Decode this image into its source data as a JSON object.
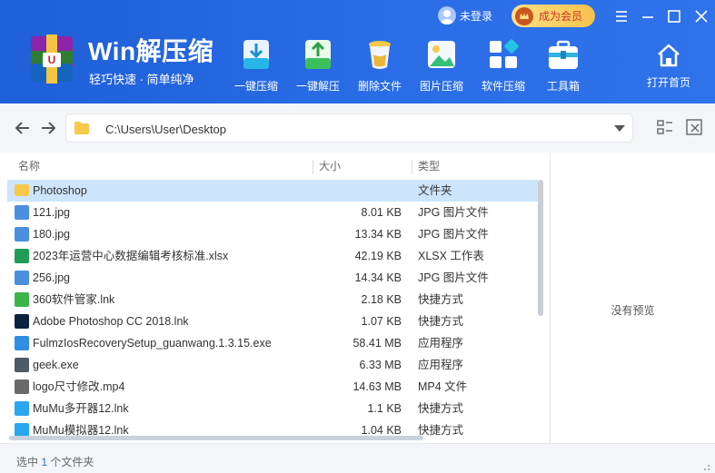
{
  "app": {
    "title": "Win解压缩",
    "subtitle": "轻巧快速 · 简单纯净"
  },
  "account": {
    "login_label": "未登录",
    "vip_label": "成为会员"
  },
  "toolbar": [
    {
      "label": "一键压缩",
      "icon": "one-click-compress-icon"
    },
    {
      "label": "一键解压",
      "icon": "one-click-extract-icon"
    },
    {
      "label": "删除文件",
      "icon": "delete-file-icon"
    },
    {
      "label": "图片压缩",
      "icon": "image-compress-icon"
    },
    {
      "label": "软件压缩",
      "icon": "software-compress-icon"
    },
    {
      "label": "工具箱",
      "icon": "toolbox-icon"
    },
    {
      "label": "打开首页",
      "icon": "home-icon"
    }
  ],
  "address": {
    "path": "C:\\Users\\User\\Desktop"
  },
  "columns": {
    "name": "名称",
    "size": "大小",
    "type": "类型"
  },
  "files": [
    {
      "name": "Photoshop",
      "size": "",
      "type": "文件夹",
      "icon": "folder-icon",
      "color": "#f7c94a",
      "selected": true
    },
    {
      "name": "121.jpg",
      "size": "8.01 KB",
      "type": "JPG 图片文件",
      "icon": "jpg-file-icon",
      "color": "#4a8fe0"
    },
    {
      "name": "180.jpg",
      "size": "13.34 KB",
      "type": "JPG 图片文件",
      "icon": "jpg-file-icon",
      "color": "#4a8fe0"
    },
    {
      "name": "2023年运营中心数据编辑考核标准.xlsx",
      "size": "42.19 KB",
      "type": "XLSX 工作表",
      "icon": "xlsx-file-icon",
      "color": "#1f9d55"
    },
    {
      "name": "256.jpg",
      "size": "14.34 KB",
      "type": "JPG 图片文件",
      "icon": "jpg-file-icon",
      "color": "#4a8fe0"
    },
    {
      "name": "360软件管家.lnk",
      "size": "2.18 KB",
      "type": "快捷方式",
      "icon": "360-app-icon",
      "color": "#3bb54a"
    },
    {
      "name": "Adobe Photoshop CC 2018.lnk",
      "size": "1.07 KB",
      "type": "快捷方式",
      "icon": "photoshop-app-icon",
      "color": "#0c2340"
    },
    {
      "name": "FulmzIosRecoverySetup_guanwang.1.3.15.exe",
      "size": "58.41 MB",
      "type": "应用程序",
      "icon": "recovery-app-icon",
      "color": "#2f8de4"
    },
    {
      "name": "geek.exe",
      "size": "6.33 MB",
      "type": "应用程序",
      "icon": "geek-app-icon",
      "color": "#4d5b66"
    },
    {
      "name": "logo尺寸修改.mp4",
      "size": "14.63 MB",
      "type": "MP4 文件",
      "icon": "video-file-icon",
      "color": "#6a6a6a"
    },
    {
      "name": "MuMu多开器12.lnk",
      "size": "1.1 KB",
      "type": "快捷方式",
      "icon": "mumu-app-icon",
      "color": "#2aa7f0"
    },
    {
      "name": "MuMu模拟器12.lnk",
      "size": "1.04 KB",
      "type": "快捷方式",
      "icon": "mumu-app-icon",
      "color": "#2aa7f0"
    }
  ],
  "preview": {
    "empty_text": "没有预览"
  },
  "status": {
    "prefix": "选中",
    "count": "1",
    "suffix": "个文件夹"
  }
}
